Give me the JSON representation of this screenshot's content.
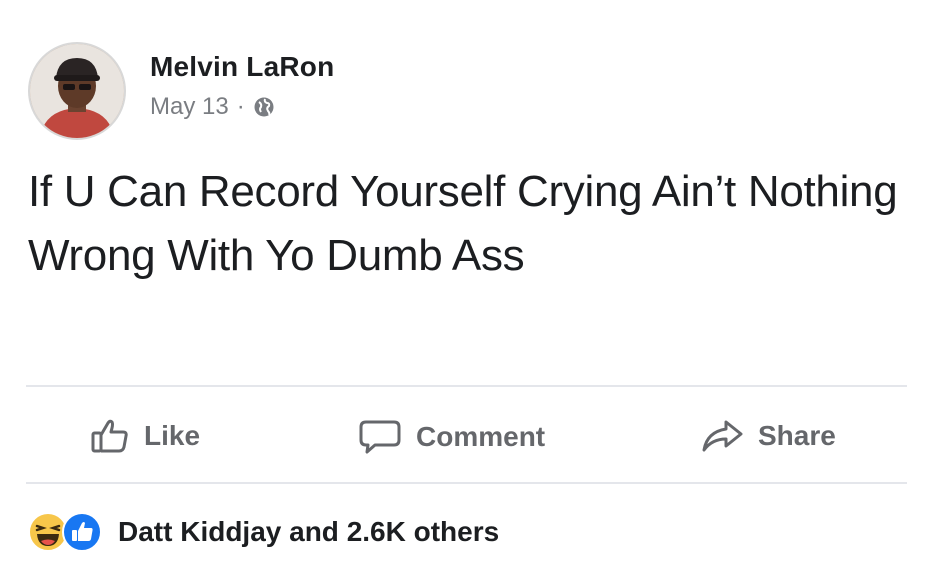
{
  "post": {
    "author": "Melvin LaRon",
    "date": "May 13",
    "separator": "·",
    "privacy_icon": "globe-icon",
    "text": "If U Can Record Yourself Crying Ain’t Nothing Wrong With Yo Dumb Ass"
  },
  "actions": {
    "like_label": "Like",
    "comment_label": "Comment",
    "share_label": "Share"
  },
  "reactions": {
    "icons": [
      "haha-reaction-icon",
      "like-reaction-icon"
    ],
    "summary": "Datt Kiddjay and 2.6K others"
  },
  "colors": {
    "text": "#1c1e21",
    "muted": "#65676b",
    "divider": "#e4e6eb",
    "like_blue": "#1877f2",
    "haha_yellow": "#f7c64a"
  }
}
